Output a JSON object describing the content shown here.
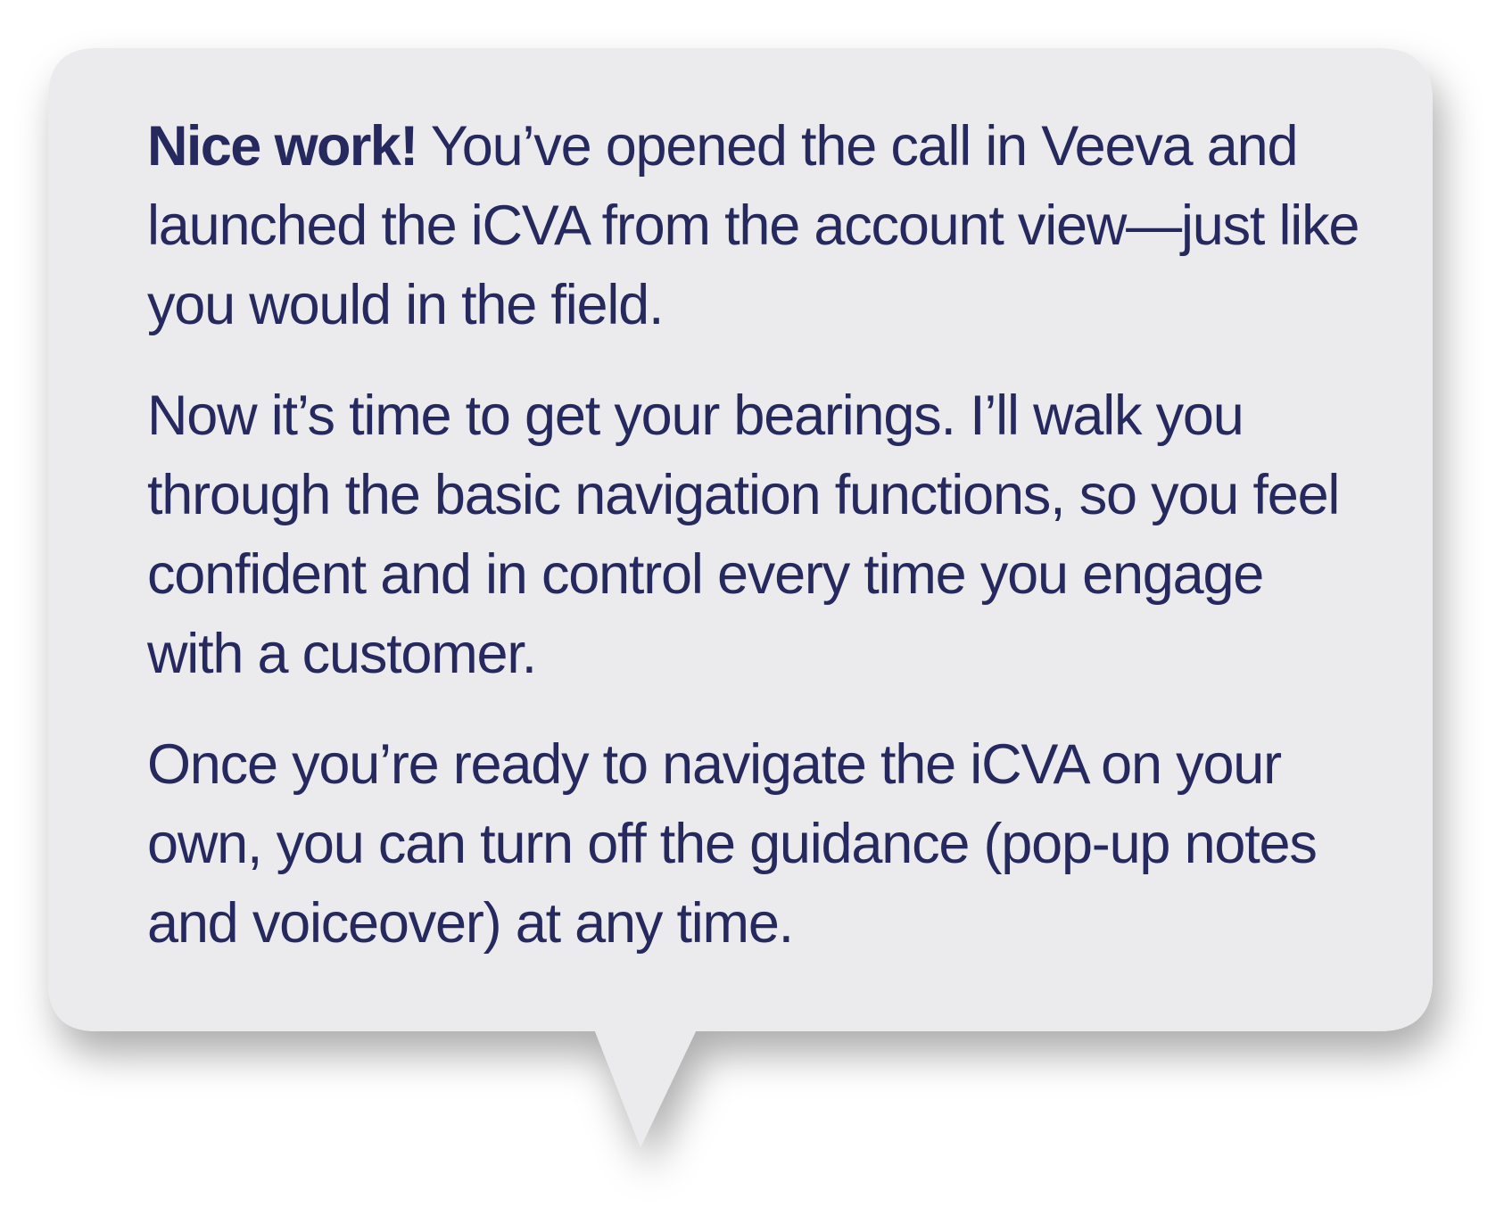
{
  "callout": {
    "paragraph_1": {
      "lead": "Nice work!",
      "text": " You’ve opened the call in Veeva and launched the iCVA from the account view—just like you would in the field."
    },
    "paragraph_2": "Now it’s time to get your bearings. I’ll walk you through the basic navigation functions, so you feel confident and in control every time you engage with a customer.",
    "paragraph_3": "Once you’re ready to navigate the iCVA on your own, you can turn off the guidance (pop-up notes and voiceover) at any time."
  },
  "colors": {
    "bubble_fill": "#ebebed",
    "text": "#26295e",
    "background": "#ffffff"
  }
}
